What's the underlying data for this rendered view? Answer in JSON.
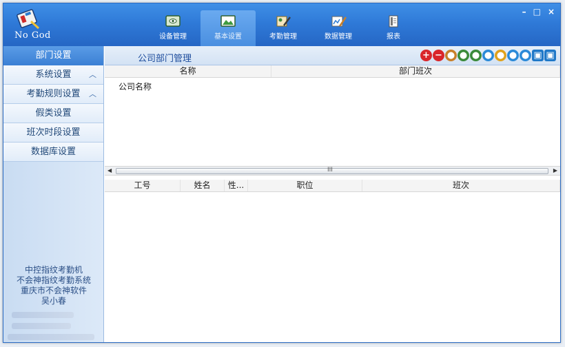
{
  "app": {
    "logo_text": "No God",
    "window_controls": [
      "–",
      "□",
      "×"
    ]
  },
  "nav": [
    {
      "label": "设备管理",
      "icon": "device-icon"
    },
    {
      "label": "基本设置",
      "icon": "landscape-icon"
    },
    {
      "label": "考勤管理",
      "icon": "attendance-icon"
    },
    {
      "label": "数据管理",
      "icon": "data-edit-icon"
    },
    {
      "label": "报表",
      "icon": "report-icon"
    }
  ],
  "sidebar": {
    "header": "部门设置",
    "items": [
      {
        "label": "系统设置",
        "chevron": "︿"
      },
      {
        "label": "考勤规则设置",
        "chevron": "︿"
      },
      {
        "label": "假类设置"
      },
      {
        "label": "班次时段设置"
      },
      {
        "label": "数据库设置"
      }
    ],
    "info": [
      "中控指纹考勤机",
      "不会神指纹考勤系统",
      "重庆市不会神软件",
      "吴小春"
    ]
  },
  "main": {
    "title": "公司部门管理",
    "tools": [
      {
        "icon": "add-icon",
        "color": "#d9262b"
      },
      {
        "icon": "remove-icon",
        "color": "#d9262b"
      },
      {
        "icon": "user-tool-icon",
        "color": "#c8802a"
      },
      {
        "icon": "user-delete-icon",
        "color": "#3a8a3a"
      },
      {
        "icon": "user-add-icon",
        "color": "#3a8a3a"
      },
      {
        "icon": "user-group-icon",
        "color": "#2b8ad8"
      },
      {
        "icon": "user-edit-icon",
        "color": "#e0a21c"
      },
      {
        "icon": "user-move-icon",
        "color": "#2b8ad8"
      },
      {
        "icon": "user-sync-icon",
        "color": "#2b8ad8"
      },
      {
        "icon": "import-icon",
        "color": "#1f78c8"
      },
      {
        "icon": "export-icon",
        "color": "#1f78c8"
      }
    ],
    "dept_grid": {
      "columns": [
        "名称",
        "部门班次"
      ],
      "rows": [
        [
          "公司名称",
          ""
        ]
      ]
    },
    "scroll_grip": "III",
    "emp_grid": {
      "columns": [
        "工号",
        "姓名",
        "性...",
        "职位",
        "班次"
      ]
    }
  },
  "colors": {
    "brand": "#2f7ad8",
    "sidebar_bg": "#d4e3f5",
    "title_text": "#1d4c9c"
  }
}
